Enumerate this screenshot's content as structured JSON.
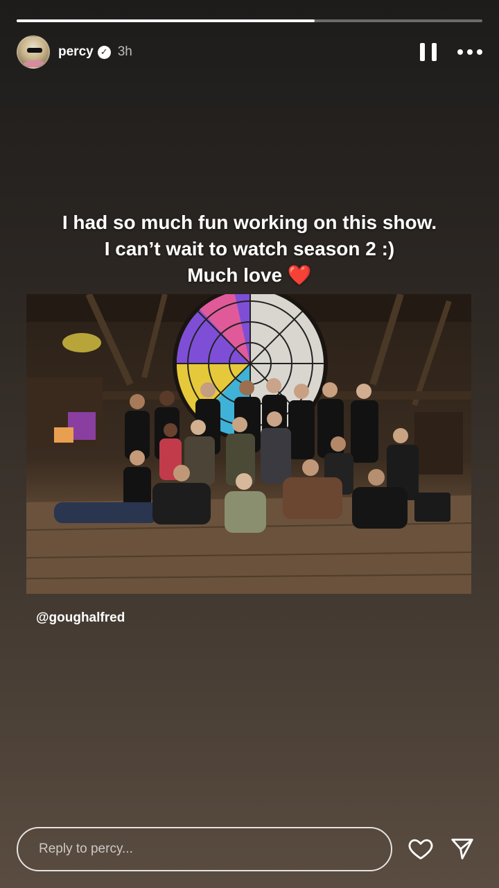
{
  "story": {
    "progress": 0.64
  },
  "header": {
    "avatar_icon": "user-avatar",
    "username": "percy",
    "verified_icon": "verified-badge-icon",
    "time": "3h",
    "pause_icon": "pause-icon",
    "more_icon": "more-options-icon"
  },
  "caption": {
    "line1": "I had so much fun working on this show.",
    "line2": "I can’t wait to watch season 2 :)",
    "line3": "Much love",
    "heart_emoji": "❤️"
  },
  "photo": {
    "description_icon": "group-photo-image"
  },
  "mention": "@goughalfred",
  "reply": {
    "placeholder": "Reply to percy...",
    "like_icon": "heart-icon",
    "send_icon": "send-icon"
  }
}
